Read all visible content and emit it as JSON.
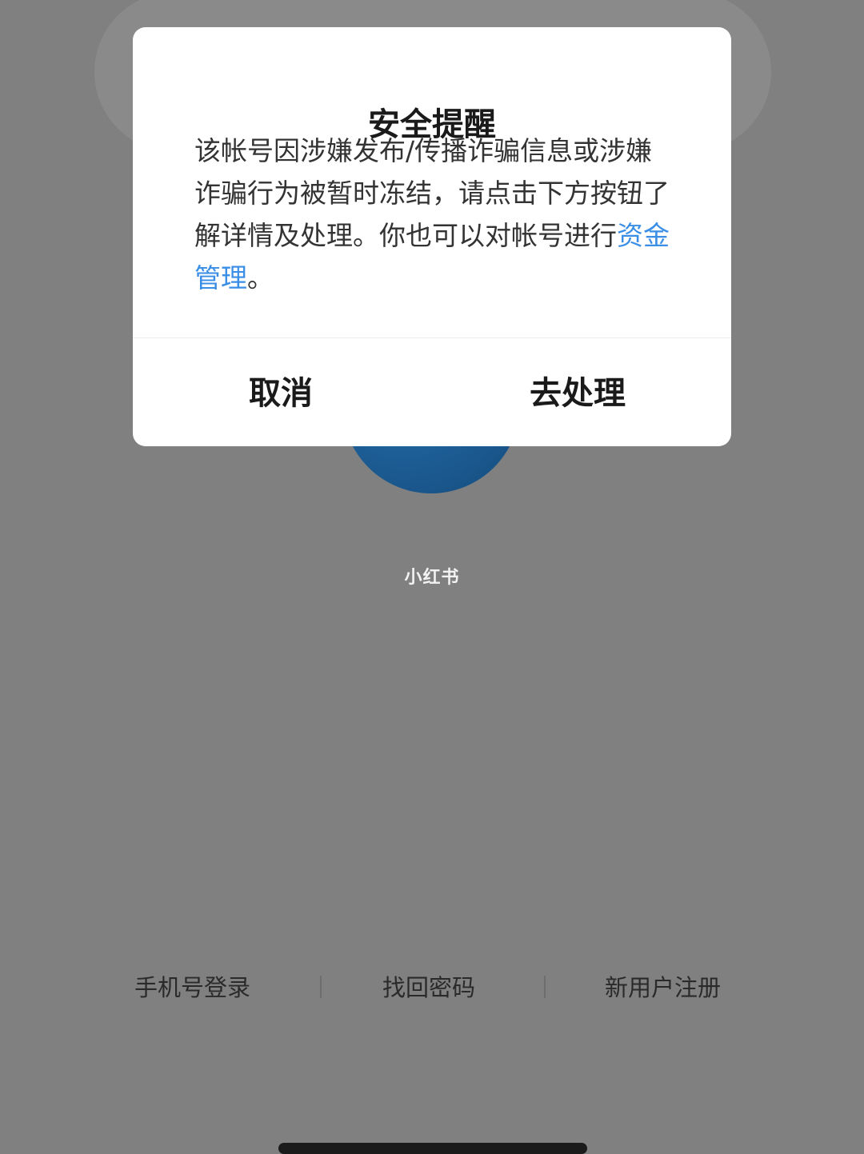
{
  "background": {
    "watermark": "小红书"
  },
  "bottom_links": {
    "phone_login": "手机号登录",
    "forgot_password": "找回密码",
    "register": "新用户注册"
  },
  "dialog": {
    "title": "安全提醒",
    "message_before_link": "该帐号因涉嫌发布/传播诈骗信息或涉嫌诈骗行为被暂时冻结，请点击下方按钮了解详情及处理。你也可以对帐号进行",
    "message_link": "资金管理",
    "message_after_link": "。",
    "cancel_label": "取消",
    "confirm_label": "去处理"
  },
  "colors": {
    "overlay": "#808080",
    "link": "#3a8ee6",
    "avatar": "#1c5c93"
  }
}
